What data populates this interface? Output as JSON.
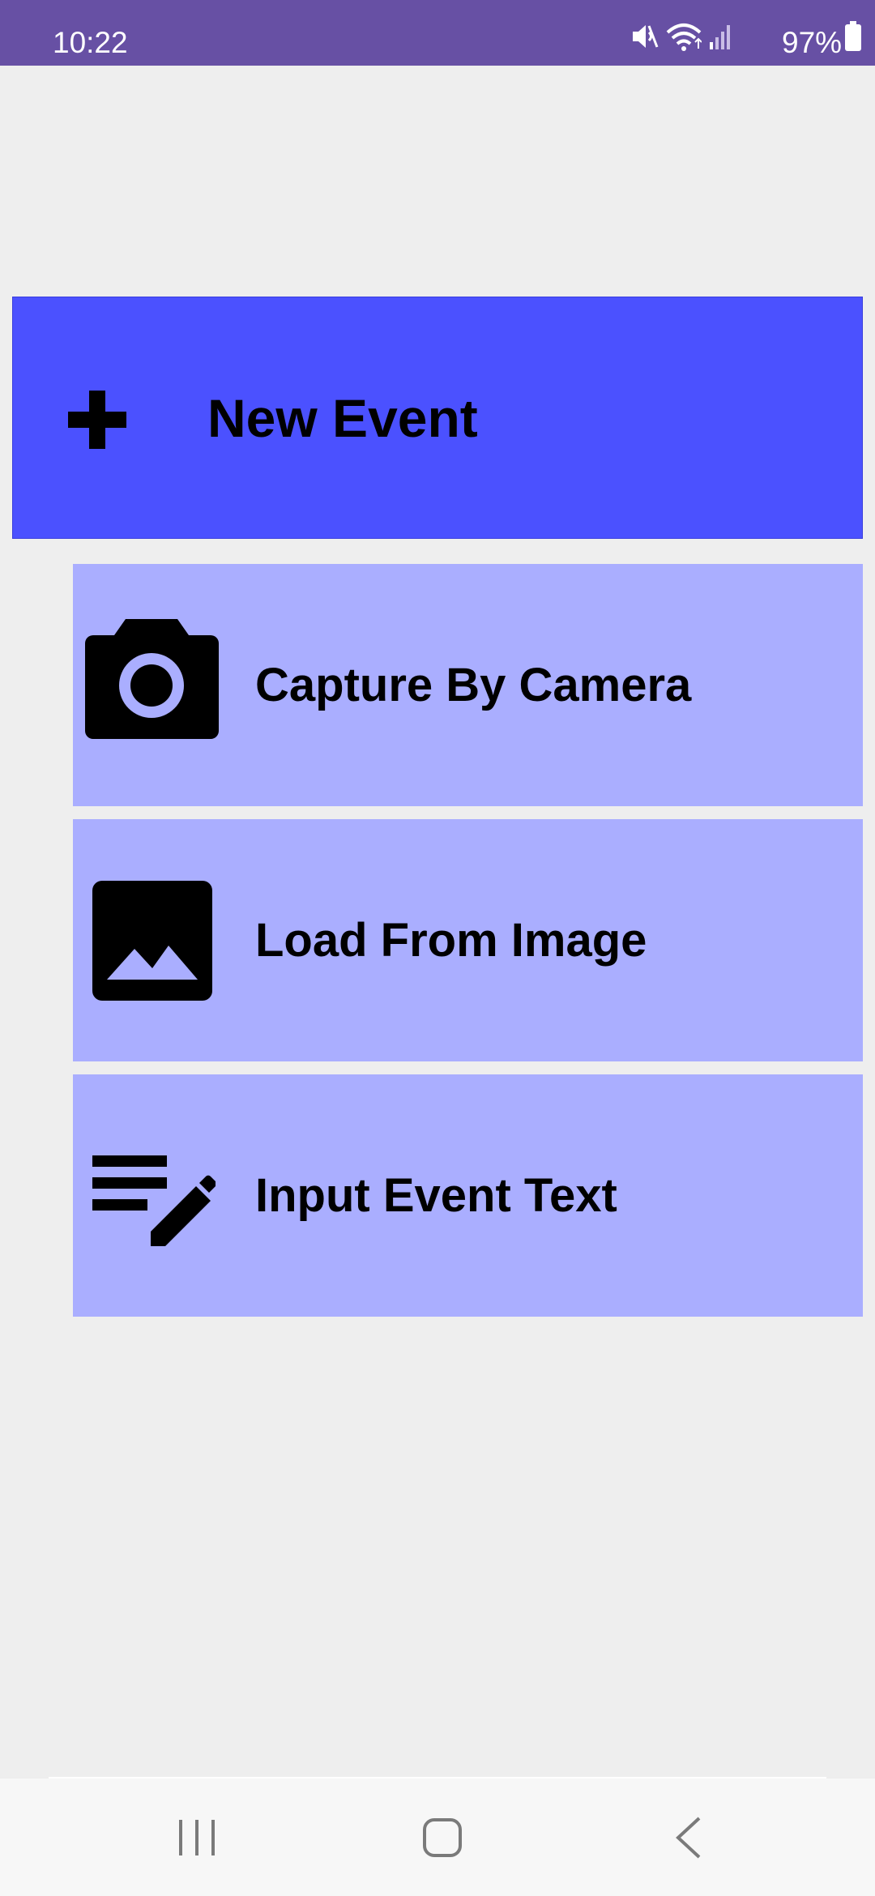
{
  "status_bar": {
    "time": "10:22",
    "battery": "97%",
    "icons": [
      "mute-icon",
      "wifi-icon",
      "signal-icon",
      "battery-icon"
    ]
  },
  "new_event": {
    "label": "New Event",
    "icon": "plus-icon",
    "color": "#4b51ff"
  },
  "options": [
    {
      "label": "Capture By Camera",
      "icon": "camera-icon"
    },
    {
      "label": "Load From Image",
      "icon": "image-icon"
    },
    {
      "label": "Input Event Text",
      "icon": "edit-text-icon"
    }
  ],
  "option_color": "#aaaeff",
  "nav_bar": {
    "buttons": [
      "recent-apps-icon",
      "home-icon",
      "back-icon"
    ]
  }
}
